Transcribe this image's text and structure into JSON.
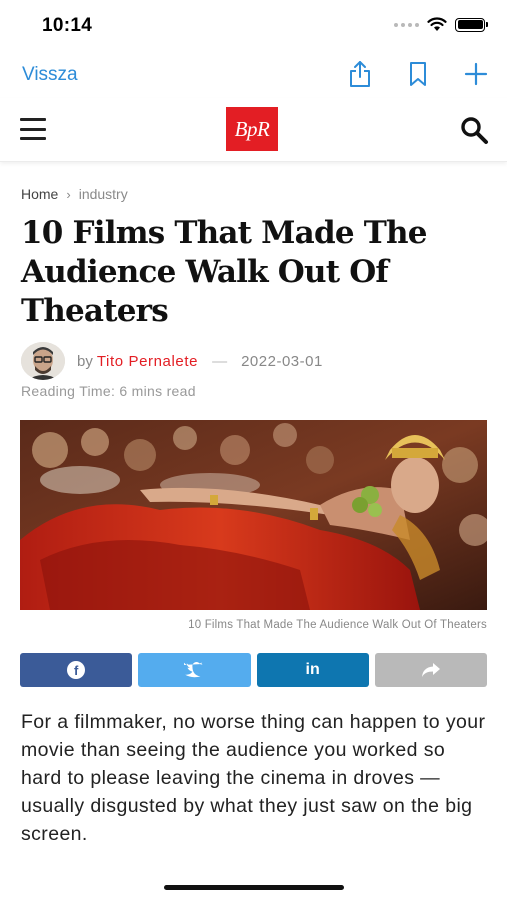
{
  "status_bar": {
    "time": "10:14"
  },
  "browser_nav": {
    "back_label": "Vissza",
    "icons": [
      "share-icon",
      "bookmark-icon",
      "plus-icon"
    ],
    "accent_color": "#2d8cd8"
  },
  "header": {
    "logo_text": "BpR",
    "logo_color": "#e31e24",
    "icons": [
      "hamburger-menu-icon",
      "search-icon"
    ]
  },
  "breadcrumb": {
    "home": "Home",
    "separator": "›",
    "current": "industry"
  },
  "article": {
    "title": "10 Films That Made The Audience Walk Out Of Theaters",
    "by_prefix": "by",
    "author": "Tito Pernalete",
    "dash": "—",
    "date": "2022-03-01",
    "reading_time": "Reading Time: 6 mins read",
    "image_caption": "10 Films That Made The Audience Walk Out Of Theaters",
    "body": "For a filmmaker, no worse thing can happen to your movie than seeing the audience you worked so hard to please leaving the cinema in droves — usually disgusted by what they just saw on the big screen."
  },
  "share": {
    "buttons": [
      {
        "network": "facebook",
        "icon": "facebook-icon",
        "glyph": "f",
        "color": "#3b5b98"
      },
      {
        "network": "twitter",
        "icon": "twitter-icon",
        "color": "#54acee"
      },
      {
        "network": "linkedin",
        "icon": "linkedin-icon",
        "glyph": "in",
        "color": "#0e76b0"
      },
      {
        "network": "more",
        "icon": "share-arrow-icon",
        "color": "#b9b9b9"
      }
    ]
  }
}
